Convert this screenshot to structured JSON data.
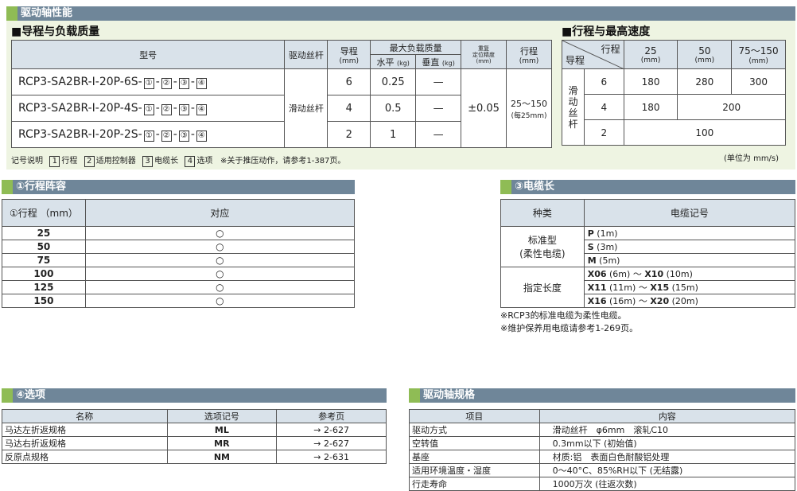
{
  "top_bar": {
    "title": "驱动轴性能"
  },
  "lead_section": {
    "title": "■导程与负载质量",
    "headers": {
      "model": "型号",
      "screw": "驱动丝杆",
      "lead": "导程",
      "lead_unit": "(mm)",
      "max_load": "最大负载质量",
      "horizontal": "水平",
      "h_unit": "(kg)",
      "vertical": "垂直",
      "v_unit": "(kg)",
      "repeat": "重复\n定位精度\n(mm)",
      "stroke": "行程",
      "stroke_unit": "(mm)"
    },
    "rows": [
      {
        "model": "RCP3-SA2BR-I-20P-6S-",
        "lead": "6",
        "horizontal": "0.25",
        "vertical": "—"
      },
      {
        "model": "RCP3-SA2BR-I-20P-4S-",
        "lead": "4",
        "horizontal": "0.5",
        "vertical": "—"
      },
      {
        "model": "RCP3-SA2BR-I-20P-2S-",
        "lead": "2",
        "horizontal": "1",
        "vertical": "—"
      }
    ],
    "model_suffix": [
      "①",
      "②",
      "③",
      "④"
    ],
    "screw": "滑动丝杆",
    "repeat": "±0.05",
    "stroke": "25～150",
    "stroke_note": "(每25mm)"
  },
  "legend": {
    "prefix": "记号说明",
    "items": [
      {
        "n": "1",
        "t": "行程"
      },
      {
        "n": "2",
        "t": "适用控制器"
      },
      {
        "n": "3",
        "t": "电缆长"
      },
      {
        "n": "4",
        "t": "选项"
      }
    ],
    "note": "※关于推压动作，请参考1-387页。"
  },
  "speed_section": {
    "title": "■行程与最高速度",
    "header_stroke": "行程",
    "header_lead": "导程",
    "cols": [
      {
        "v": "25",
        "u": "(mm)"
      },
      {
        "v": "50",
        "u": "(mm)"
      },
      {
        "v": "75～150",
        "u": "(mm)"
      }
    ],
    "screw": "滑动丝杆",
    "rows": [
      {
        "lead": "6",
        "v": [
          "180",
          "280",
          "300"
        ]
      },
      {
        "lead": "4",
        "v": [
          "180",
          "200"
        ]
      },
      {
        "lead": "2",
        "v": [
          "100"
        ]
      }
    ],
    "unit_note": "(单位为 mm/s)"
  },
  "stroke_list": {
    "bar": "①行程阵容",
    "h1": "①行程 （mm）",
    "h2": "对应",
    "rows": [
      "25",
      "50",
      "75",
      "100",
      "125",
      "150"
    ],
    "mark": "○"
  },
  "cable": {
    "bar": "③电缆长",
    "h1": "种类",
    "h2": "电缆记号",
    "std_label": "标准型",
    "std_sub": "(柔性电缆)",
    "std": [
      {
        "c": "P",
        "l": "(1m)"
      },
      {
        "c": "S",
        "l": "(3m)"
      },
      {
        "c": "M",
        "l": "(5m)"
      }
    ],
    "spec_label": "指定长度",
    "spec": [
      {
        "a": "X06",
        "al": "(6m)",
        "b": "X10",
        "bl": "(10m)"
      },
      {
        "a": "X11",
        "al": "(11m)",
        "b": "X15",
        "bl": "(15m)"
      },
      {
        "a": "X16",
        "al": "(16m)",
        "b": "X20",
        "bl": "(20m)"
      }
    ],
    "tilde": "～",
    "notes": [
      "※RCP3的标准电缆为柔性电缆。",
      "※维护保养用电缆请参考1-269页。"
    ]
  },
  "options": {
    "bar": "④选项",
    "h": [
      "名称",
      "选项记号",
      "参考页"
    ],
    "rows": [
      {
        "n": "马达左折返规格",
        "c": "ML",
        "p": "→ 2-627"
      },
      {
        "n": "马达右折返规格",
        "c": "MR",
        "p": "→ 2-627"
      },
      {
        "n": "反原点规格",
        "c": "NM",
        "p": "→ 2-631"
      }
    ]
  },
  "spec": {
    "bar": "驱动轴规格",
    "h": [
      "项目",
      "内容"
    ],
    "rows": [
      {
        "k": "驱动方式",
        "v": "滑动丝杆　φ6mm　滚轧C10"
      },
      {
        "k": "空转值",
        "v": "0.3mm以下 (初始值)"
      },
      {
        "k": "基座",
        "v": "材质:铝　表面白色耐酸铝处理"
      },
      {
        "k": "适用环境温度・湿度",
        "v": "0～40°C、85%RH以下 (无结露)"
      },
      {
        "k": "行走寿命",
        "v": "1000万次 (往返次数)"
      }
    ]
  }
}
